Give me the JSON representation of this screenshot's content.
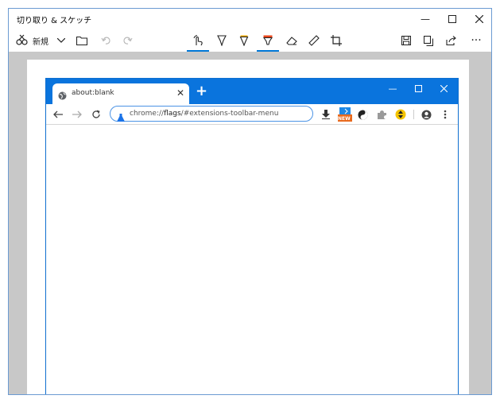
{
  "window": {
    "title": "切り取り & スケッチ"
  },
  "toolbar": {
    "new_label": "新規"
  },
  "browser": {
    "tab_title": "about:blank",
    "new_tab_symbol": "+",
    "omnibox": {
      "scheme": "chrome://",
      "host": "flags",
      "path": "/#extensions-toolbar-menu"
    },
    "new_badge": "NEW"
  }
}
